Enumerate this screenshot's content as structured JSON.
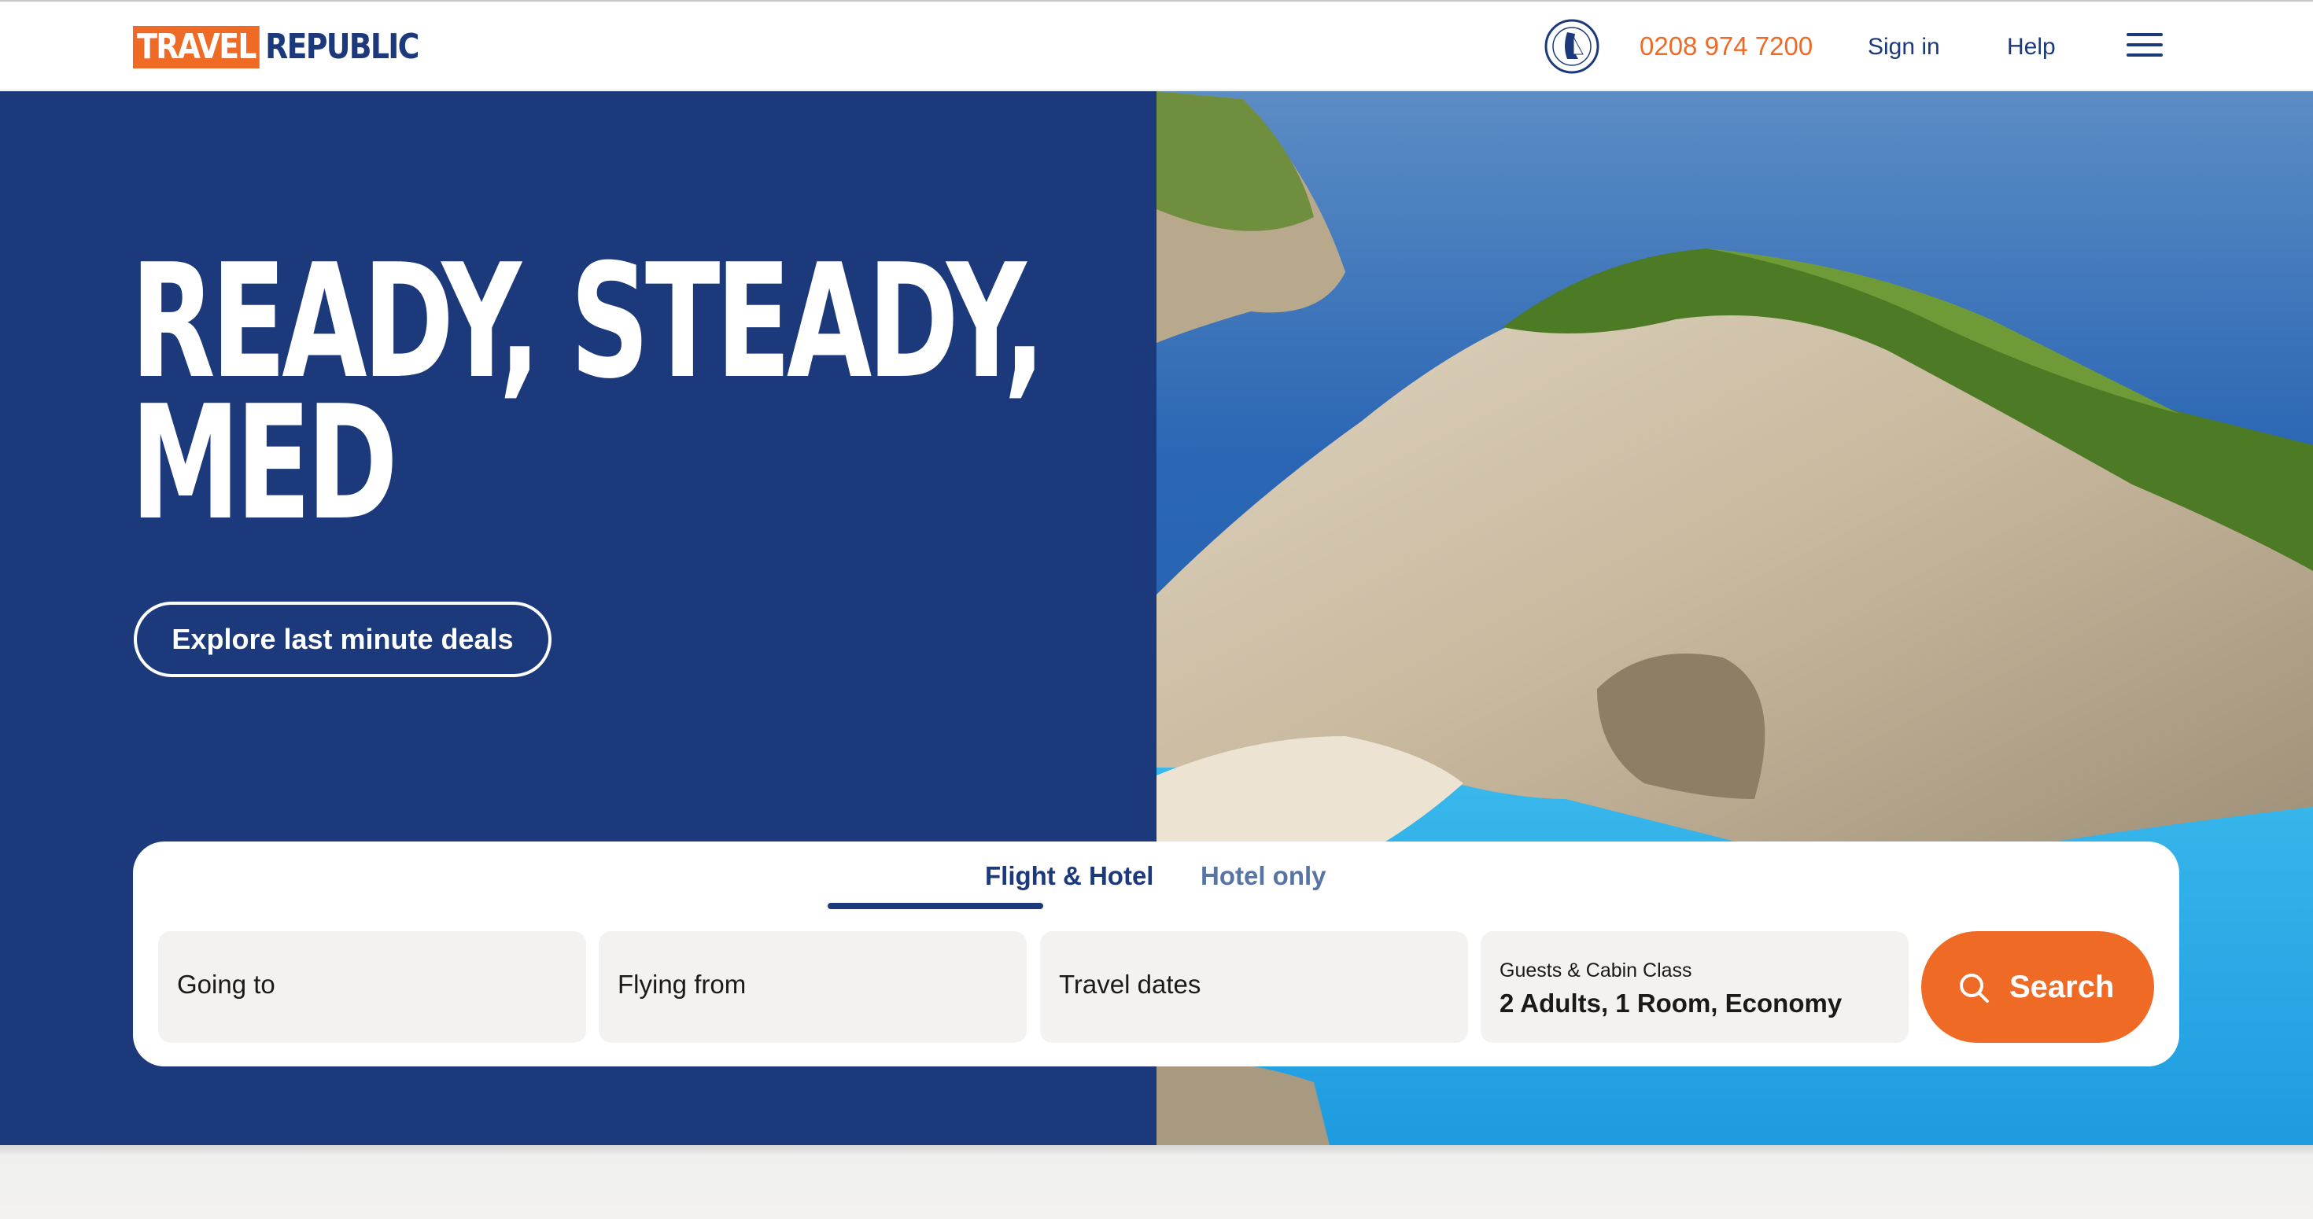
{
  "header": {
    "logo_travel": "TRAVEL",
    "logo_republic": "REPUBLIC",
    "atol_badge_icon": "atol-protected-badge-icon",
    "phone": "0208 974 7200",
    "sign_in": "Sign in",
    "help": "Help",
    "menu_icon": "hamburger-menu-icon"
  },
  "hero": {
    "title_line1": "READY, STEADY,",
    "title_line2": "MED",
    "cta_label": "Explore last minute deals",
    "image_description_icon": "navagio-beach-photo"
  },
  "search": {
    "tabs": [
      {
        "label": "Flight & Hotel",
        "active": true
      },
      {
        "label": "Hotel only",
        "active": false
      }
    ],
    "going_to": "Going to",
    "flying_from": "Flying from",
    "travel_dates": "Travel dates",
    "guests_label": "Guests & Cabin Class",
    "guests_value": "2 Adults, 1 Room, Economy",
    "button_label": "Search",
    "button_icon": "search-icon"
  },
  "colors": {
    "brand_navy": "#1c3a7b",
    "brand_orange": "#ee6a25",
    "field_bg": "#f3f2f0"
  }
}
